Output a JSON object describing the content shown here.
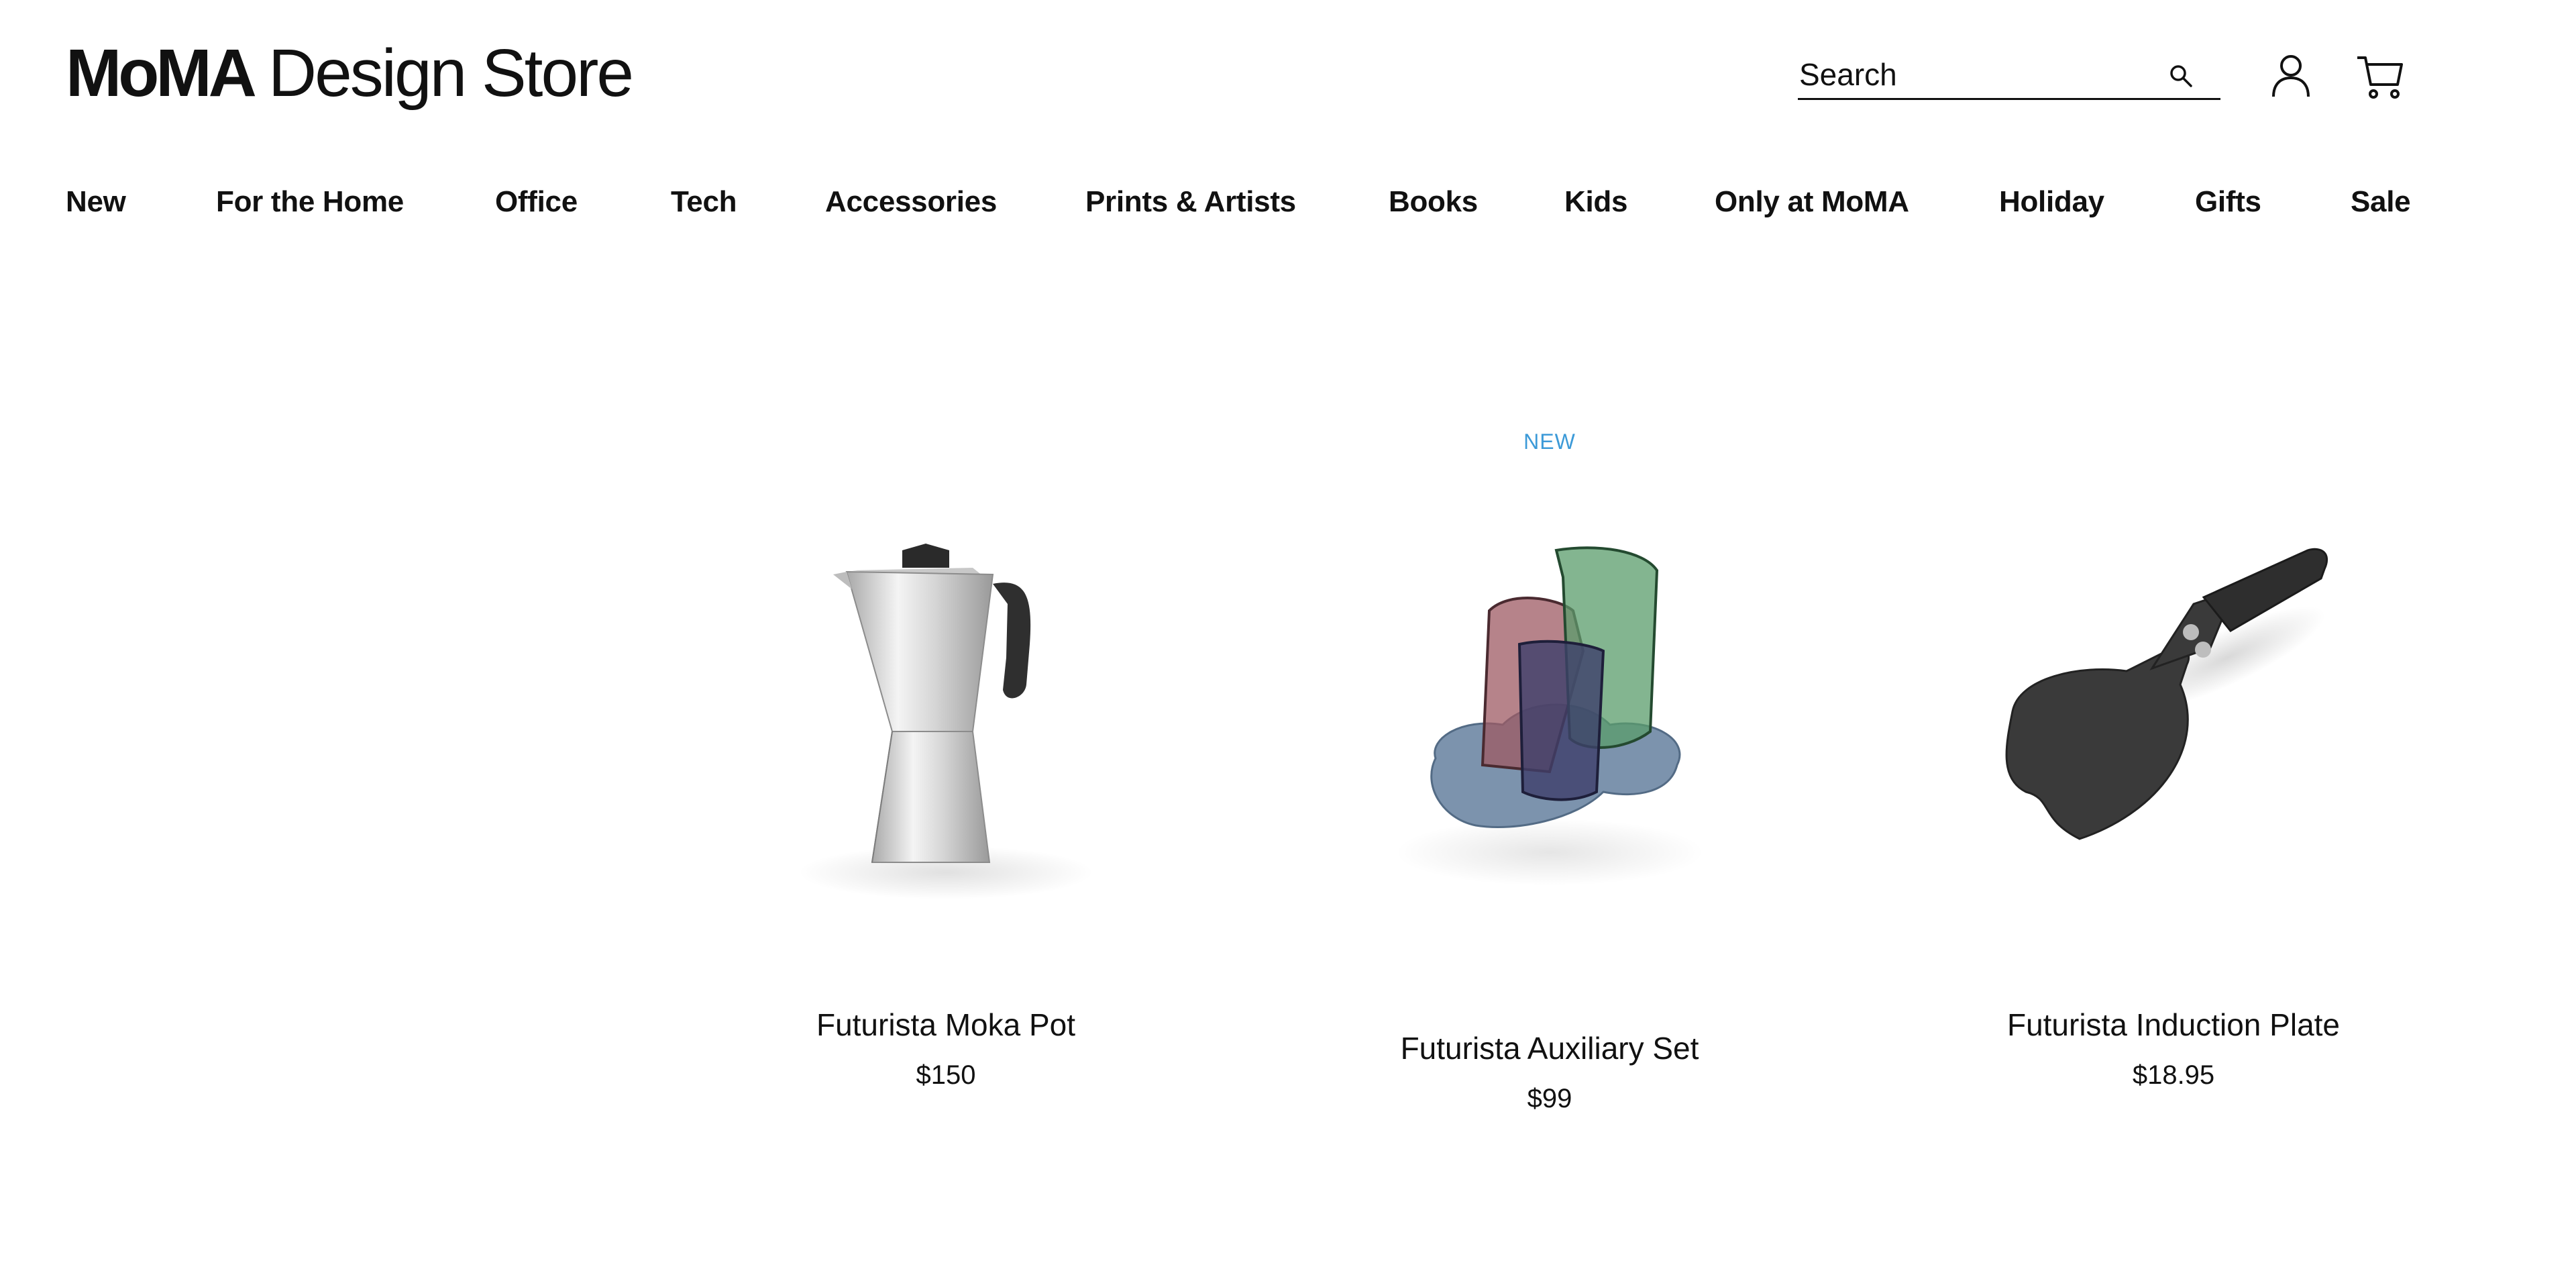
{
  "header": {
    "logo_bold": "MoMA",
    "logo_light": "Design Store",
    "search_placeholder": "Search"
  },
  "nav": {
    "items": [
      "New",
      "For the Home",
      "Office",
      "Tech",
      "Accessories",
      "Prints & Artists",
      "Books",
      "Kids",
      "Only at MoMA",
      "Holiday",
      "Gifts",
      "Sale"
    ]
  },
  "products": [
    {
      "name": "Futurista Moka Pot",
      "price": "$150",
      "badge": ""
    },
    {
      "name": "Futurista Auxiliary Set",
      "price": "$99",
      "badge": "NEW"
    },
    {
      "name": "Futurista Induction Plate",
      "price": "$18.95",
      "badge": ""
    }
  ],
  "icons": {
    "search": "search-icon",
    "account": "account-icon",
    "cart": "cart-icon"
  },
  "colors": {
    "text": "#111111",
    "badge": "#3c9ad8",
    "background": "#ffffff"
  }
}
